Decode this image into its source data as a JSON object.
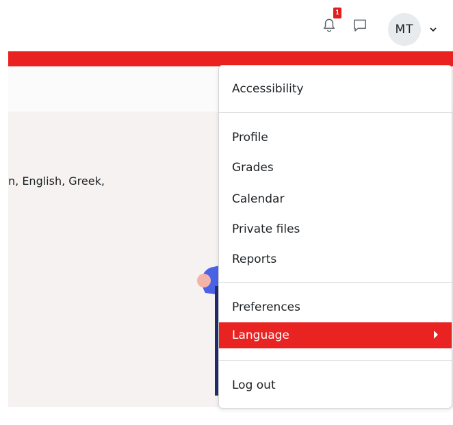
{
  "navbar": {
    "notification_count": "1",
    "avatar_initials": "MT",
    "icons": [
      "bell-icon",
      "chat-icon",
      "chevron-down-icon"
    ]
  },
  "content": {
    "text": "n, English, Greek,"
  },
  "user_menu": {
    "items": [
      {
        "label": "Accessibility"
      },
      {
        "label": "Profile"
      },
      {
        "label": "Grades"
      },
      {
        "label": "Calendar"
      },
      {
        "label": "Private files"
      },
      {
        "label": "Reports"
      },
      {
        "label": "Preferences"
      },
      {
        "label": "Language",
        "active": true
      },
      {
        "label": "Log out"
      }
    ]
  },
  "colors": {
    "accent": "#ea2121",
    "content_bg": "#f5f2f1",
    "avatar_bg": "#e8ebee"
  }
}
